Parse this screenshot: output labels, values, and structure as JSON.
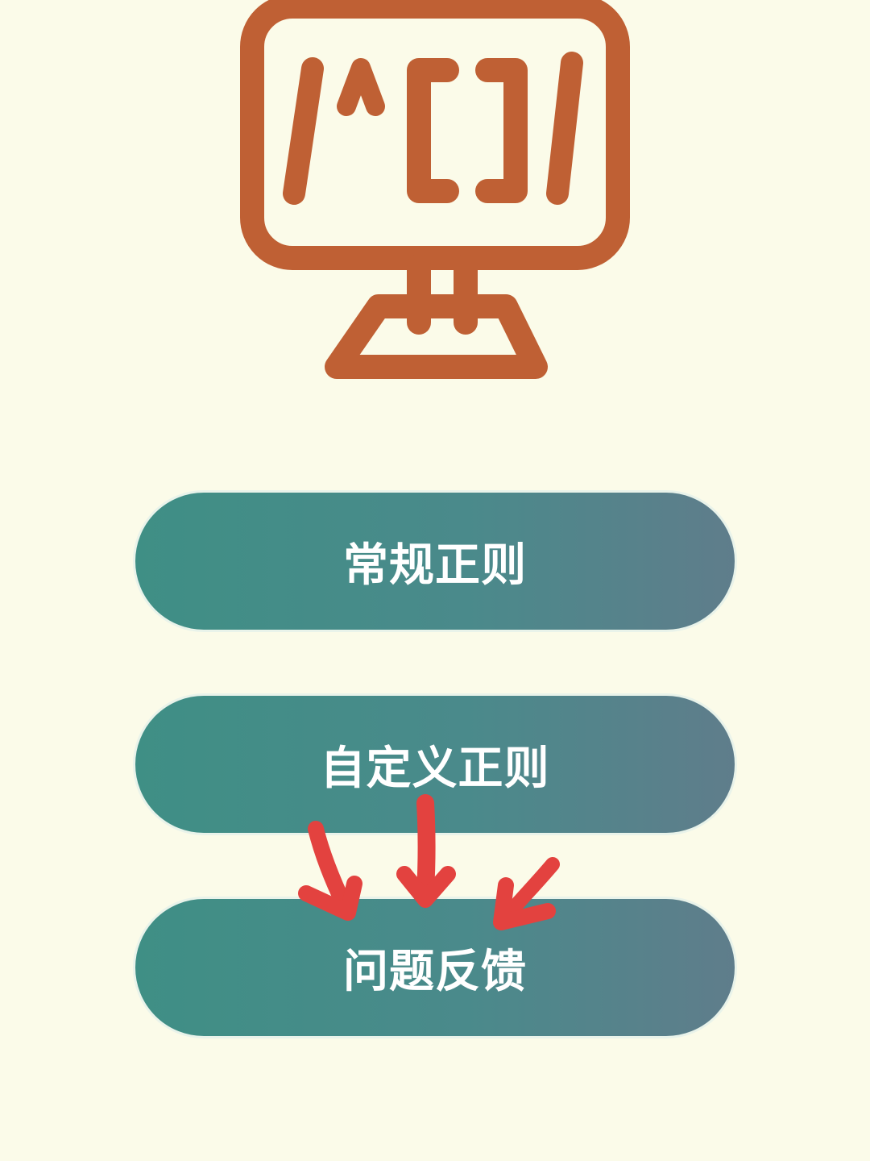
{
  "app": {
    "logo_icon": "monitor-regex-icon",
    "brand_color": "#bf6034",
    "background_color": "#fbfbe9"
  },
  "menu": {
    "buttons": [
      {
        "label": "常规正则"
      },
      {
        "label": "自定义正则"
      },
      {
        "label": "问题反馈"
      }
    ],
    "button_gradient": [
      "#3f8f85",
      "#5f7d8b"
    ]
  },
  "annotation": {
    "icon": "red-arrows-annotation-icon",
    "color": "#e3423f"
  }
}
